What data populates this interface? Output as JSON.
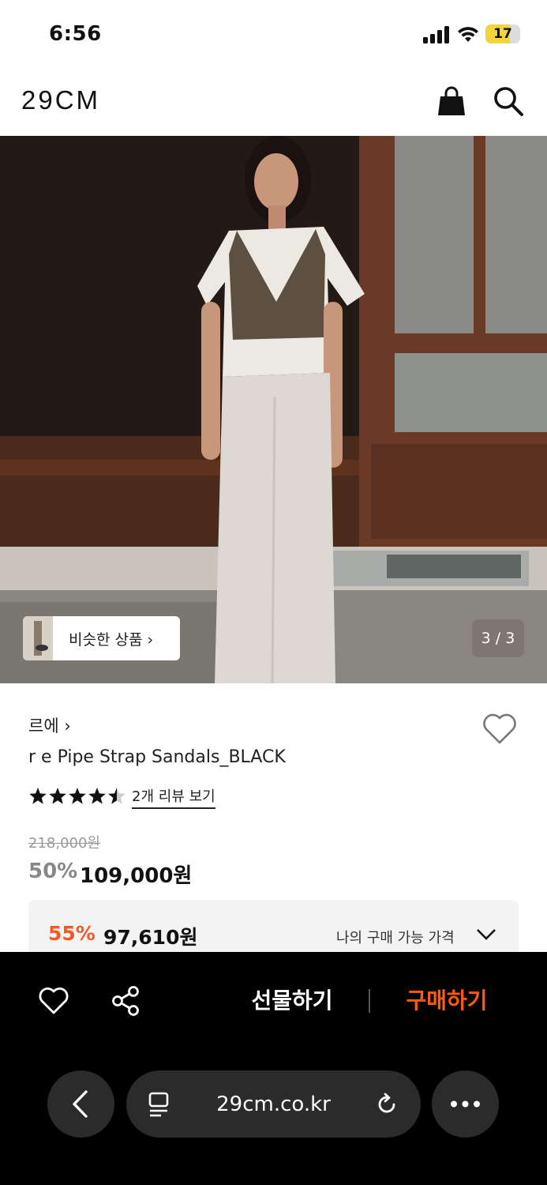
{
  "status_bar": {
    "time": "6:56",
    "battery_level": "17",
    "battery_color": "#f4d43b"
  },
  "header": {
    "logo": "29CM",
    "icons": [
      "shopping-bag-icon",
      "search-icon"
    ]
  },
  "gallery": {
    "similar_products_label": "비슷한 상품 ›",
    "page_indicator": "3 / 3"
  },
  "product": {
    "brand": "르에 ›",
    "name": "r e Pipe Strap Sandals_BLACK",
    "rating": 4.5,
    "review_link": "2개 리뷰 보기",
    "original_price": "218,000원",
    "discount_percent": "50%",
    "sale_price": "109,000원"
  },
  "my_price": {
    "discount_percent": "55%",
    "price": "97,610원",
    "label": "나의 구매 가능 가격",
    "accent_color": "#f15a24"
  },
  "action_bar": {
    "gift_label": "선물하기",
    "buy_label": "구매하기",
    "buy_color": "#ff5a12"
  },
  "browser": {
    "url": "29cm.co.kr"
  }
}
